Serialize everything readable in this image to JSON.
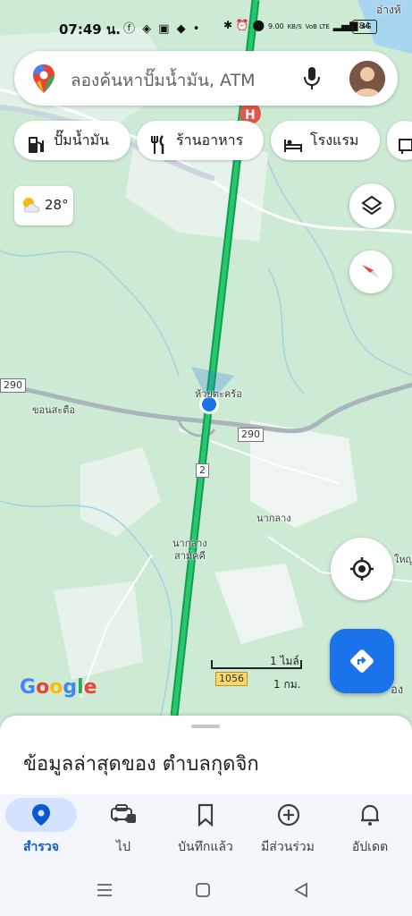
{
  "status_bar": {
    "time": "07:49 น.",
    "net_speed_value": "9.00",
    "net_speed_unit": "KB/S",
    "volte": "VoB LTE",
    "signal": "4G",
    "battery": "84"
  },
  "search": {
    "placeholder": "ลองค้นหาปั๊มน้ำมัน, ATM"
  },
  "chips": [
    {
      "label": "ปั๊มน้ำมัน",
      "icon": "gas-station-icon"
    },
    {
      "label": "ร้านอาหาร",
      "icon": "restaurant-icon"
    },
    {
      "label": "โรงแรม",
      "icon": "hotel-icon"
    }
  ],
  "weather": {
    "temp": "28°",
    "icon": "partly-cloudy-icon"
  },
  "map": {
    "labels": {
      "top_right": "อ่างห้",
      "current_place": "ห้วยตะคร้อ",
      "west_village": "ขอนสะตือ",
      "village_1": "นากลาง",
      "village_2a": "นากลาง",
      "village_2b": "สามัคคี",
      "right_edge_1": "ใหญ่",
      "right_edge_2": "อง"
    },
    "shields": {
      "route_290_west": "290",
      "route_290_mid": "290",
      "route_2": "2",
      "route_1056": "1056"
    },
    "scale": {
      "miles": "1 ไมล์",
      "km": "1 กม."
    },
    "attribution": "Google",
    "highlight_color": "#1db954",
    "location_color": "#1a73e8"
  },
  "sheet": {
    "title": "ข้อมูลล่าสุดของ ตำบลกุดจิก"
  },
  "bottom_nav": [
    {
      "label": "สำรวจ",
      "icon": "explore-pin-icon",
      "active": true
    },
    {
      "label": "ไป",
      "icon": "car-icon",
      "active": false
    },
    {
      "label": "บันทึกแล้ว",
      "icon": "bookmark-icon",
      "active": false
    },
    {
      "label": "มีส่วนร่วม",
      "icon": "add-circle-icon",
      "active": false
    },
    {
      "label": "อัปเดต",
      "icon": "bell-icon",
      "active": false
    }
  ]
}
